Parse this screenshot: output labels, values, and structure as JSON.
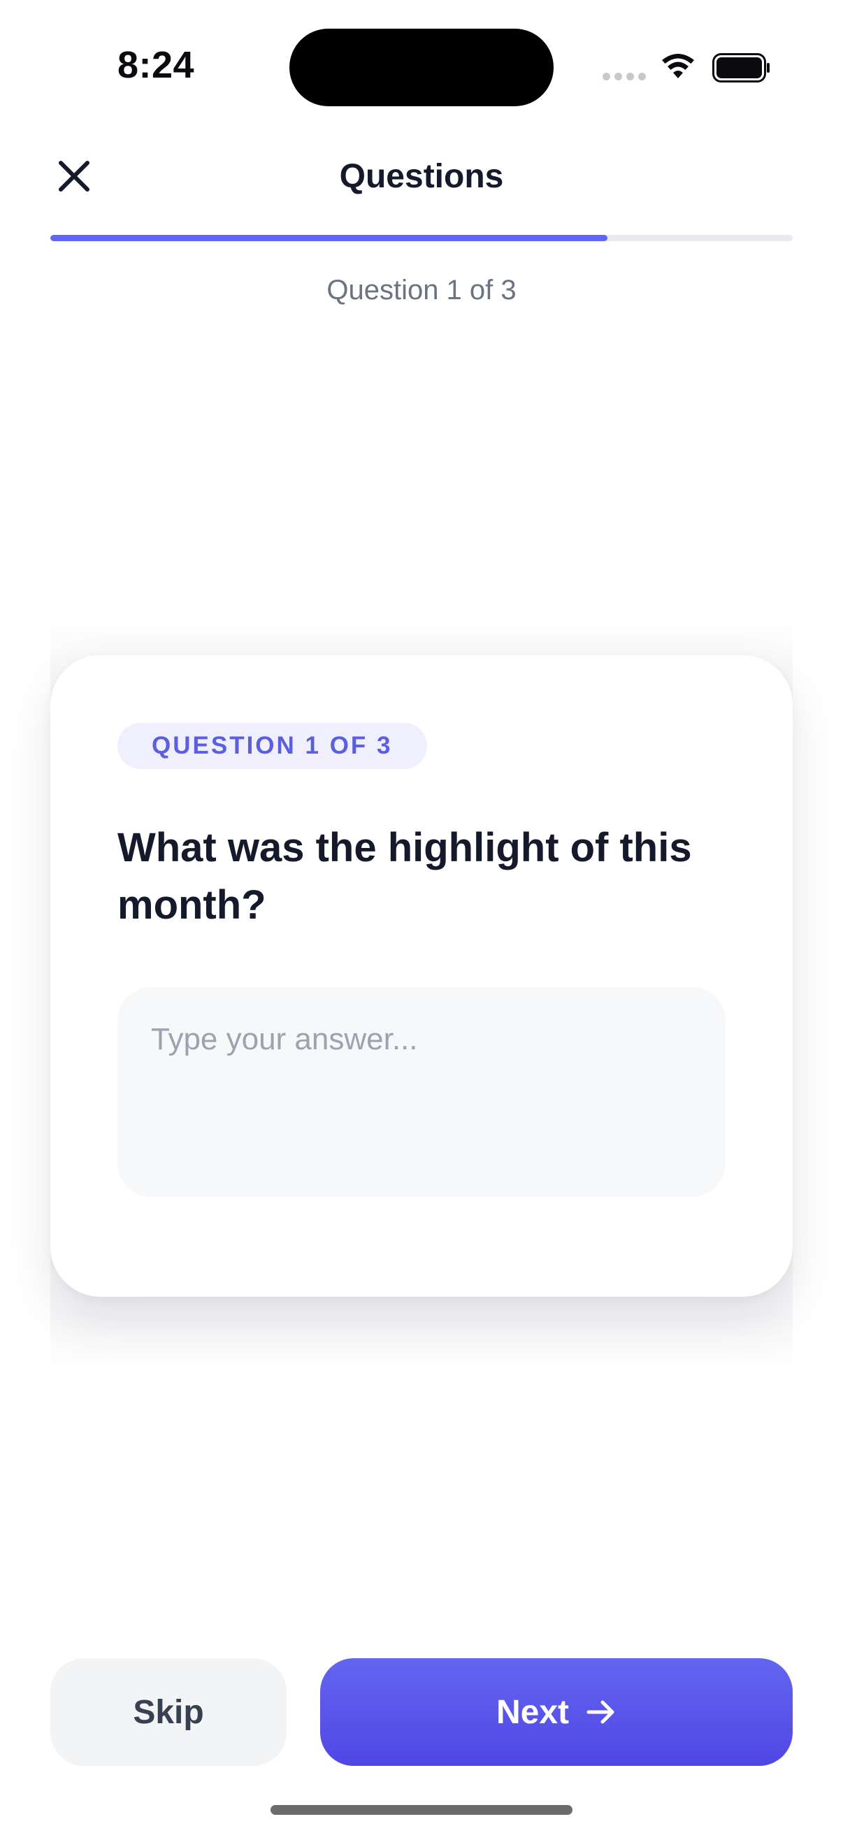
{
  "status_bar": {
    "time": "8:24"
  },
  "header": {
    "title": "Questions",
    "close_icon": "close-icon",
    "progress_fraction": 0.75,
    "progress_text": "Question 1 of 3"
  },
  "card": {
    "badge": "QUESTION 1 OF 3",
    "question": "What was the highlight of this month?",
    "answer_value": "",
    "answer_placeholder": "Type your answer..."
  },
  "footer": {
    "skip_label": "Skip",
    "next_label": "Next",
    "next_icon": "arrow-right-icon"
  },
  "colors": {
    "accent": "#6366f1",
    "accent_dark": "#5046e4",
    "badge_bg": "#efeffd",
    "badge_text": "#5b5ee0",
    "text_primary": "#141a2b",
    "text_secondary": "#6b7280"
  }
}
